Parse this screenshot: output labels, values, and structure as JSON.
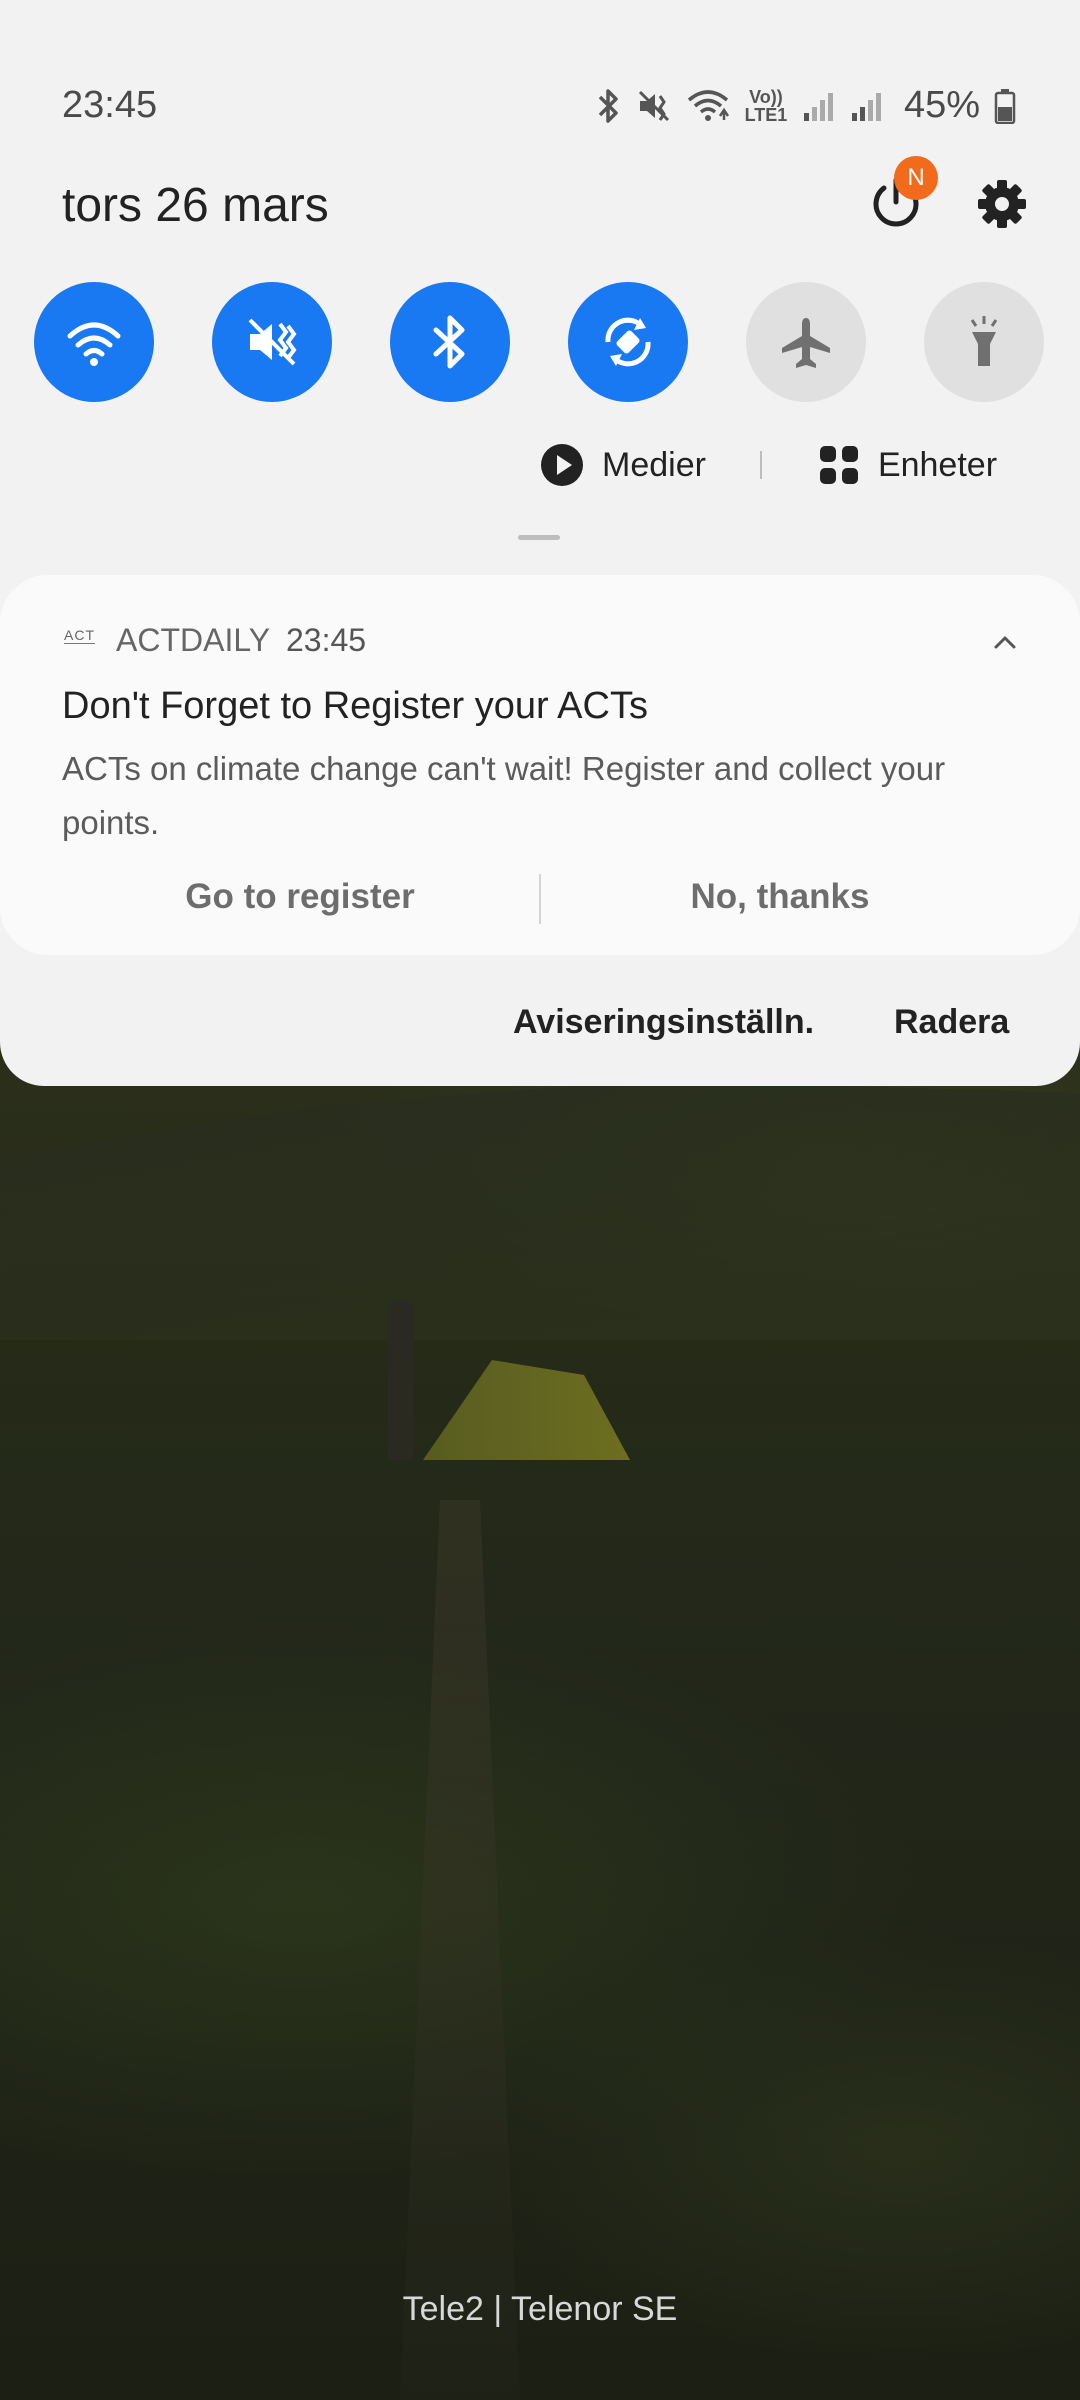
{
  "status_bar": {
    "time": "23:45",
    "battery_percent": "45%",
    "icons": [
      "bluetooth-icon",
      "mute-icon",
      "wifi-call-icon",
      "volte-icon",
      "signal-icon",
      "signal-icon",
      "battery-icon"
    ],
    "volte_label": "Vo)) LTE1"
  },
  "quick_panel": {
    "date": "tors 26 mars",
    "power_badge": "N",
    "toggles": [
      {
        "name": "wifi",
        "state": "on"
      },
      {
        "name": "mute",
        "state": "on"
      },
      {
        "name": "bluetooth",
        "state": "on"
      },
      {
        "name": "auto-rotate",
        "state": "on"
      },
      {
        "name": "airplane-mode",
        "state": "off"
      },
      {
        "name": "flashlight",
        "state": "off"
      }
    ],
    "media_label": "Medier",
    "devices_label": "Enheter"
  },
  "notification": {
    "app_icon_text": "ACT",
    "app_name": "ACTDAILY",
    "time": "23:45",
    "title": "Don't Forget to Register your ACTs",
    "body": "ACTs on climate change can't wait! Register and collect your points.",
    "actions": [
      "Go to register",
      "No, thanks"
    ]
  },
  "footer": {
    "settings_label": "Aviseringsinställn.",
    "clear_label": "Radera"
  },
  "lockscreen": {
    "carrier": "Tele2 | Telenor SE"
  },
  "colors": {
    "accent": "#1979f3",
    "badge": "#f26a1b",
    "panel_bg": "#f2f2f2"
  }
}
